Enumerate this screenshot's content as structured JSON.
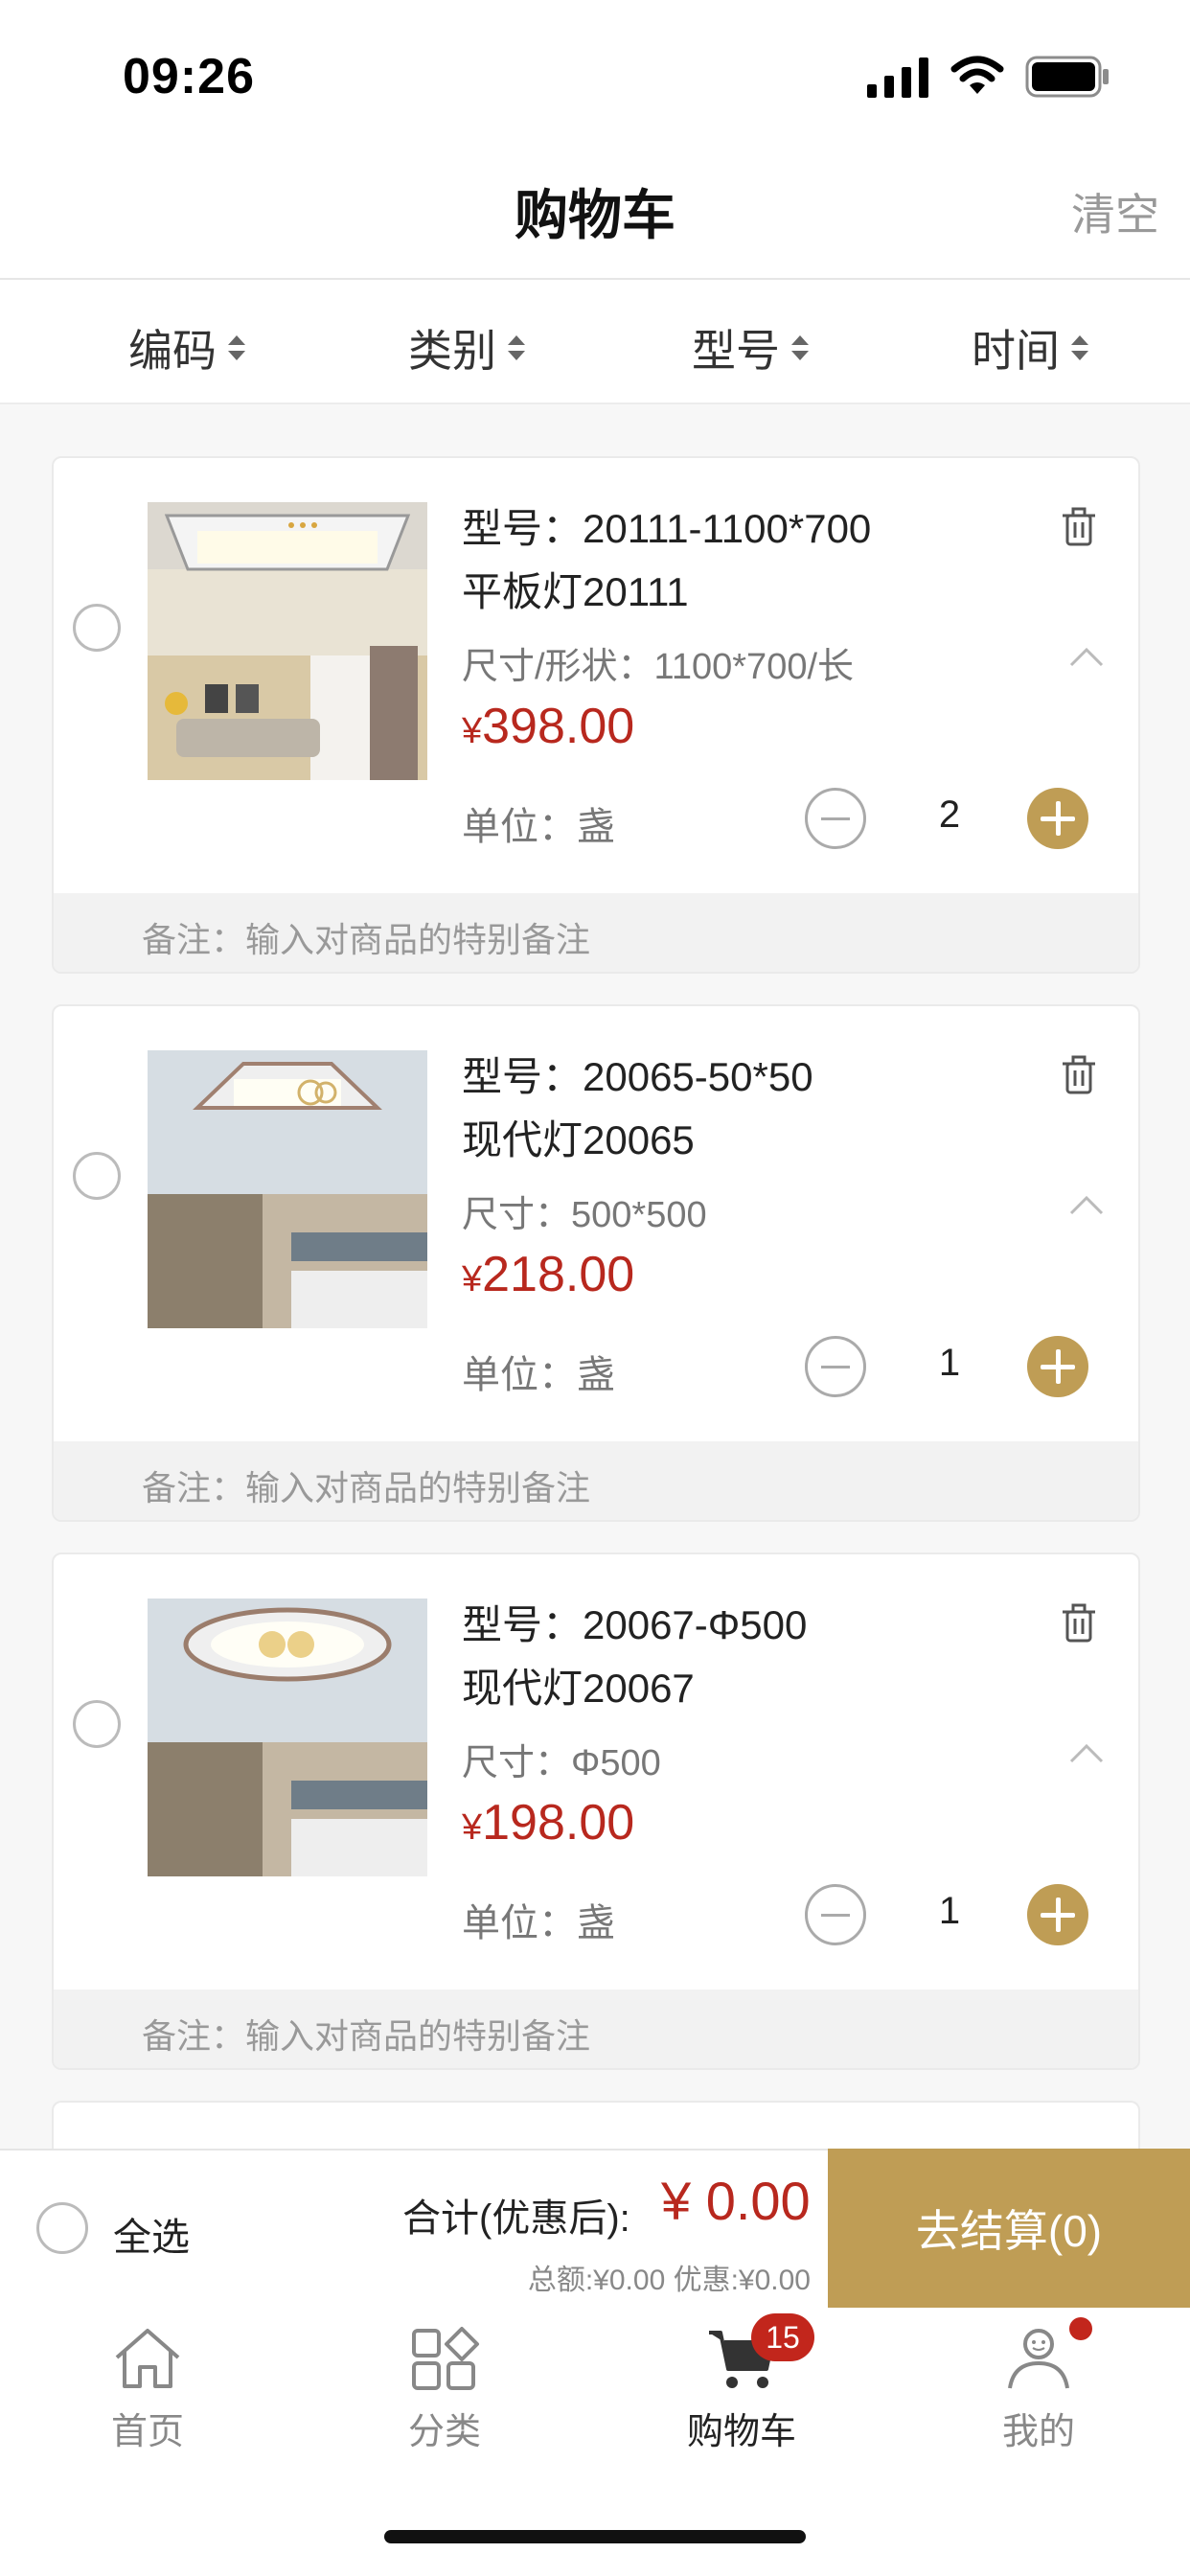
{
  "status_bar": {
    "time": "09:26"
  },
  "nav": {
    "title": "购物车",
    "clear": "清空"
  },
  "sort": [
    {
      "label": "编码"
    },
    {
      "label": "类别"
    },
    {
      "label": "型号"
    },
    {
      "label": "时间"
    }
  ],
  "items": [
    {
      "model": "型号：20111-1100*700",
      "name": "平板灯20111",
      "size": "尺寸/形状：1100*700/长",
      "price_symbol": "¥",
      "price": "398.00",
      "unit": "单位：盏",
      "qty": "2",
      "note": "备注：输入对商品的特别备注"
    },
    {
      "model": "型号：20065-50*50",
      "name": "现代灯20065",
      "size": "尺寸：500*500",
      "price_symbol": "¥",
      "price": "218.00",
      "unit": "单位：盏",
      "qty": "1",
      "note": "备注：输入对商品的特别备注"
    },
    {
      "model": "型号：20067-Φ500",
      "name": "现代灯20067",
      "size": "尺寸：Φ500",
      "price_symbol": "¥",
      "price": "198.00",
      "unit": "单位：盏",
      "qty": "1",
      "note": "备注：输入对商品的特别备注"
    }
  ],
  "checkout": {
    "select_all": "全选",
    "total_label": "合计(优惠后):",
    "total_value": "¥ 0.00",
    "summary": "总额:¥0.00 优惠:¥0.00",
    "button": "去结算(0)"
  },
  "tabbar": {
    "items": [
      {
        "label": "首页",
        "icon": "home-icon"
      },
      {
        "label": "分类",
        "icon": "category-icon"
      },
      {
        "label": "购物车",
        "icon": "cart-icon"
      },
      {
        "label": "我的",
        "icon": "profile-icon"
      }
    ],
    "cart_badge": "15"
  },
  "colors": {
    "accent": "#bf9d55",
    "price": "#b8281e",
    "badge": "#c2261c"
  }
}
